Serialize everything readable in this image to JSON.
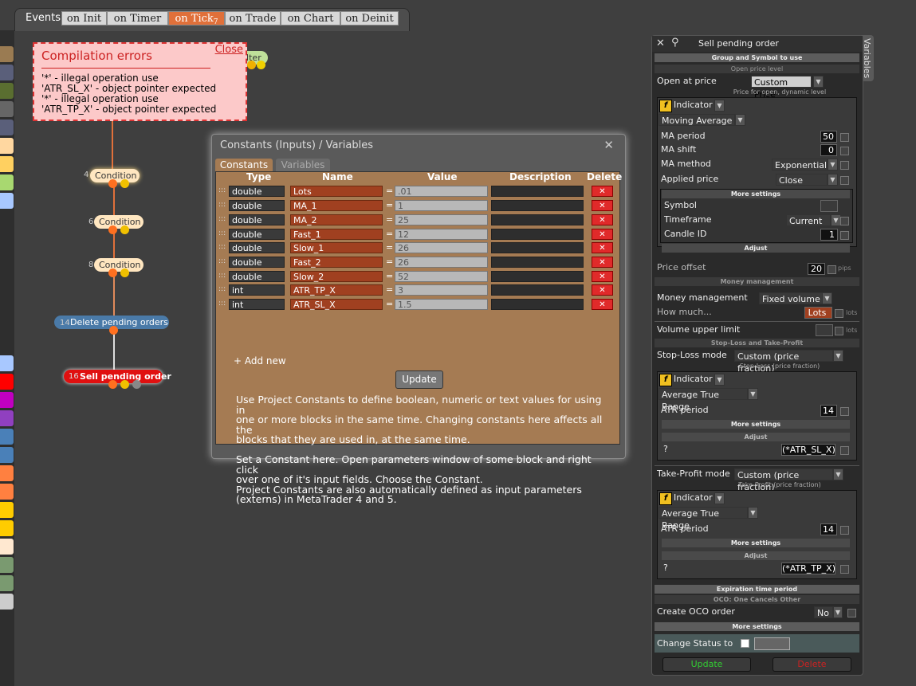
{
  "events": {
    "label": "Events",
    "tabs": [
      "on Init",
      "on Timer",
      "on Tick",
      "on Trade",
      "on Chart",
      "on Deinit"
    ],
    "active_badge": "7"
  },
  "errors": {
    "title": "Compilation errors",
    "close": "Close",
    "messages": [
      "'*' - illegal operation use",
      "'ATR_SL_X' - object pointer expected",
      "'*' - illegal operation use",
      "'ATR_TP_X' - object pointer expected"
    ]
  },
  "nodes": [
    {
      "num": "",
      "label": "ilter"
    },
    {
      "num": "4",
      "label": "Condition"
    },
    {
      "num": "6",
      "label": "Condition"
    },
    {
      "num": "8",
      "label": "Condition"
    },
    {
      "num": "14",
      "label": "Delete pending orders"
    },
    {
      "num": "16",
      "label": "Sell pending order"
    }
  ],
  "constants": {
    "title": "Constants (Inputs) / Variables",
    "close": "✕",
    "tabs": [
      "Constants",
      "Variables"
    ],
    "headers": [
      "Type",
      "Name",
      "Value",
      "Description",
      "Delete"
    ],
    "rows": [
      {
        "type": "double",
        "name": "Lots",
        "value": ".01",
        "description": ""
      },
      {
        "type": "double",
        "name": "MA_1",
        "value": "1",
        "description": ""
      },
      {
        "type": "double",
        "name": "MA_2",
        "value": "25",
        "description": ""
      },
      {
        "type": "double",
        "name": "Fast_1",
        "value": "12",
        "description": ""
      },
      {
        "type": "double",
        "name": "Slow_1",
        "value": "26",
        "description": ""
      },
      {
        "type": "double",
        "name": "Fast_2",
        "value": "26",
        "description": ""
      },
      {
        "type": "double",
        "name": "Slow_2",
        "value": "52",
        "description": ""
      },
      {
        "type": "int",
        "name": "ATR_TP_X",
        "value": "3",
        "description": ""
      },
      {
        "type": "int",
        "name": "ATR_SL_X",
        "value": "1.5",
        "description": ""
      }
    ],
    "grip": ":::",
    "eq": "=",
    "delete_glyph": "✕",
    "add_new": "+ Add new",
    "update": "Update",
    "help": [
      "Use Project Constants to define boolean, numeric or text values for using in",
      "one or more blocks in the same time. Changing constants here affects all the",
      "blocks that they are used in, at the same time.",
      "",
      "Set a Constant here. Open parameters window of some block and right click",
      "over one of it's input fields. Choose the Constant.",
      "Project Constants are also automatically defined as input parameters",
      "(externs) in MetaTrader 4 and 5."
    ]
  },
  "panel": {
    "title": "Sell pending order",
    "variables_tab": "Variables",
    "group_symbol": "Group and Symbol to use",
    "open_price_level": "Open price level",
    "open_at_price": "Open at price",
    "open_at_price_value": "Custom Price",
    "price_hint": "Price for open, dynamic level",
    "indicator": "Indicator",
    "f_glyph": "f",
    "ma": {
      "indicator": "Moving Average",
      "period_label": "MA period",
      "period": "50",
      "shift_label": "MA shift",
      "shift": "0",
      "method_label": "MA method",
      "method": "Exponential",
      "applied_label": "Applied price",
      "applied": "Close price",
      "more": "More settings",
      "symbol_label": "Symbol",
      "symbol": "",
      "timeframe_label": "Timeframe",
      "timeframe": "Current",
      "candle_label": "Candle ID",
      "candle": "1",
      "adjust": "Adjust"
    },
    "price_offset_label": "Price offset",
    "price_offset": "20",
    "pips": "pips",
    "money_management": "Money management",
    "mm_label": "Money management",
    "mm_value": "Fixed volume",
    "how_much_label": "How much...",
    "how_much": "Lots",
    "lots": "lots",
    "vol_upper_label": "Volume upper limit",
    "vol_upper": "",
    "lots2": "lots",
    "sl_tp": "Stop-Loss and Take-Profit",
    "sl_mode_label": "Stop-Loss mode",
    "sl_mode": "Custom (price fraction)",
    "sl_hint": "Stop-Loss (price fraction)",
    "sl": {
      "indicator": "Average True Range",
      "atr_label": "ATR period",
      "atr": "14",
      "more": "More settings",
      "adjust": "Adjust",
      "q": "?",
      "expr": "(*ATR_SL_X)"
    },
    "tp_mode_label": "Take-Profit mode",
    "tp_mode": "Custom (price fraction)",
    "tp_hint": "Take-Profit (price fraction)",
    "tp": {
      "indicator": "Average True Range",
      "atr_label": "ATR period",
      "atr": "14",
      "more": "More settings",
      "adjust": "Adjust",
      "q": "?",
      "expr": "(*ATR_TP_X)"
    },
    "expiration": "Expiration time period",
    "oco": "OCO: One Cancels Other",
    "oco_label": "Create OCO order",
    "oco_value": "No",
    "more": "More settings",
    "change_status": "Change Status to",
    "update": "Update",
    "delete": "Delete"
  }
}
